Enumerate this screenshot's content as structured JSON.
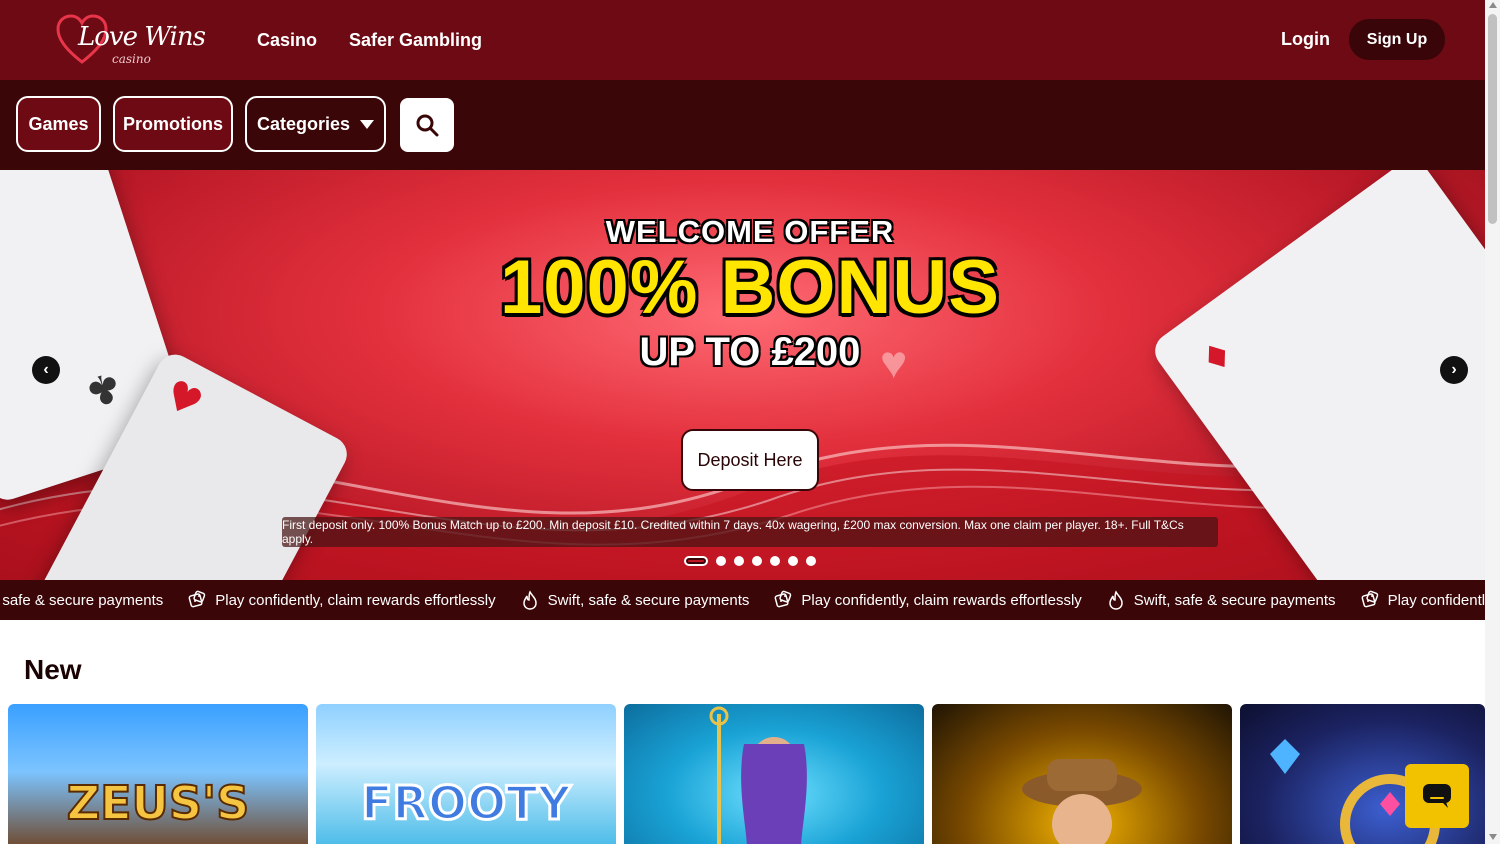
{
  "header": {
    "logo_text": "Love Wins",
    "logo_sub": "casino",
    "nav": [
      "Casino",
      "Safer Gambling"
    ],
    "login_label": "Login",
    "signup_label": "Sign Up"
  },
  "subnav": {
    "games_label": "Games",
    "promotions_label": "Promotions",
    "categories_label": "Categories",
    "search_icon": "search-icon"
  },
  "hero": {
    "line1": "WELCOME OFFER",
    "line2": "100% BONUS",
    "line3": "UP TO £200",
    "cta_label": "Deposit Here",
    "terms": "First deposit only. 100% Bonus Match up to £200. Min deposit £10. Credited within 7 days. 40x wagering, £200 max conversion. Max one claim per player. 18+. Full T&Cs apply.",
    "prev_icon": "chevron-left-icon",
    "next_icon": "chevron-right-icon",
    "slide_count": 7,
    "active_slide": 1
  },
  "ticker": {
    "items": [
      {
        "text": ", safe & secure payments",
        "icon": ""
      },
      {
        "text": "Play confidently, claim rewards effortlessly",
        "icon": "dice-icon"
      },
      {
        "text": "Swift, safe & secure payments",
        "icon": "flame-icon"
      },
      {
        "text": "Play confidently, claim rewards effortlessly",
        "icon": "dice-icon"
      },
      {
        "text": "Swift, safe & secure payments",
        "icon": "flame-icon"
      },
      {
        "text": "Play confidently",
        "icon": "dice-icon"
      }
    ]
  },
  "new_section": {
    "title": "New",
    "games": [
      {
        "name": "ZEUS'S"
      },
      {
        "name": "FROOTY"
      },
      {
        "name": ""
      },
      {
        "name": ""
      },
      {
        "name": ""
      }
    ]
  },
  "chat": {
    "icon": "chat-icon"
  },
  "colors": {
    "header": "#6d0a14",
    "subnav": "#3b0608",
    "bonus_yellow": "#ffe500",
    "chat": "#f2c200"
  }
}
